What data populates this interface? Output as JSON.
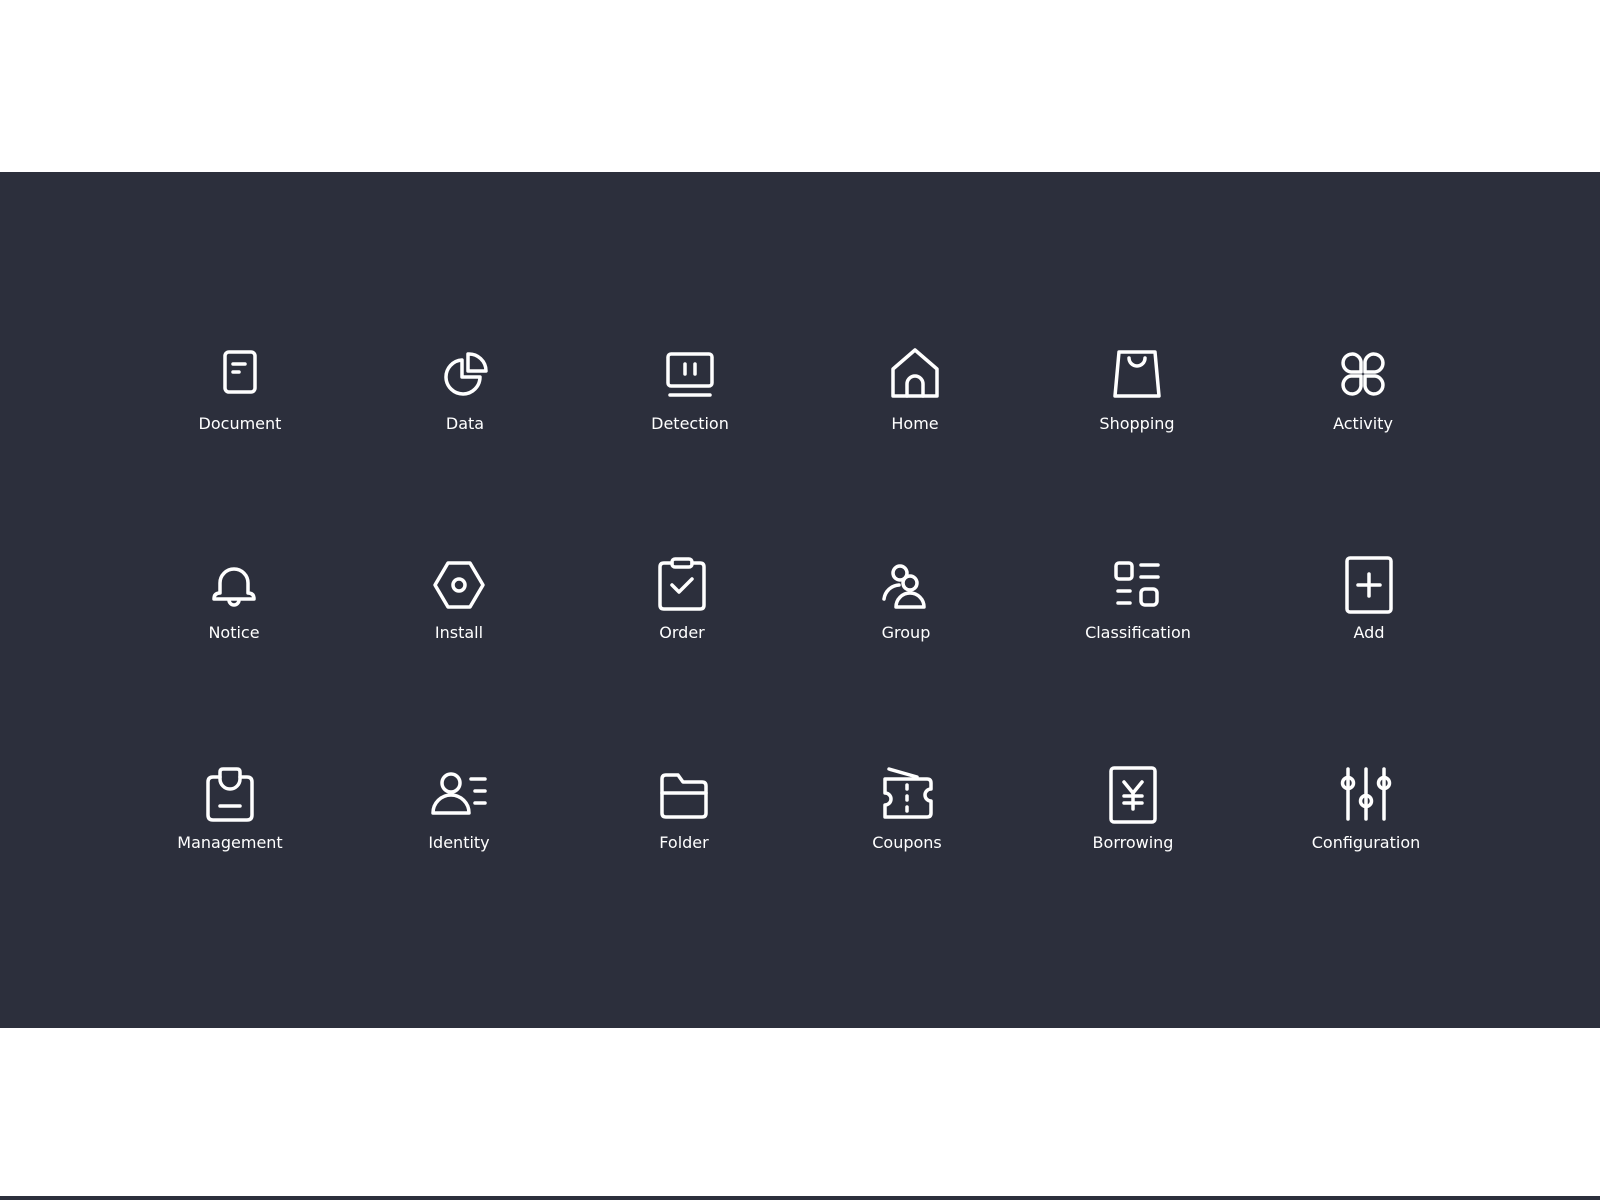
{
  "colors": {
    "panel_bg": "#2c2f3c",
    "page_bg": "#ffffff",
    "icon": "#ffffff"
  },
  "icons": [
    {
      "label": "Document",
      "icon": "document-icon"
    },
    {
      "label": "Data",
      "icon": "pie-chart-icon"
    },
    {
      "label": "Detection",
      "icon": "monitor-icon"
    },
    {
      "label": "Home",
      "icon": "home-icon"
    },
    {
      "label": "Shopping",
      "icon": "shopping-bag-icon"
    },
    {
      "label": "Activity",
      "icon": "clover-icon"
    },
    {
      "label": "Notice",
      "icon": "bell-icon"
    },
    {
      "label": "Install",
      "icon": "hex-nut-icon"
    },
    {
      "label": "Order",
      "icon": "clipboard-check-icon"
    },
    {
      "label": "Group",
      "icon": "users-icon"
    },
    {
      "label": "Classification",
      "icon": "category-list-icon"
    },
    {
      "label": "Add",
      "icon": "plus-square-icon"
    },
    {
      "label": "Management",
      "icon": "inbox-tray-icon"
    },
    {
      "label": "Identity",
      "icon": "user-card-icon"
    },
    {
      "label": "Folder",
      "icon": "folder-icon"
    },
    {
      "label": "Coupons",
      "icon": "ticket-icon"
    },
    {
      "label": "Borrowing",
      "icon": "yen-receipt-icon"
    },
    {
      "label": "Configuration",
      "icon": "sliders-icon"
    }
  ]
}
